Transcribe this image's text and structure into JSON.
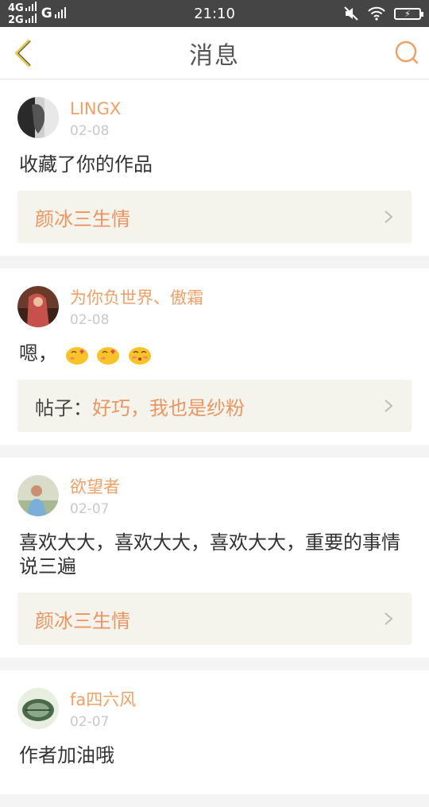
{
  "status_bar": {
    "network_top": "4G",
    "network_bottom": "2G",
    "carrier": "G",
    "time": "21:10"
  },
  "header": {
    "title": "消息",
    "back_icon": "chevron-left-icon",
    "search_icon": "search-icon"
  },
  "messages": [
    {
      "username": "LINGX",
      "date": "02-08",
      "text": "收藏了你的作品",
      "ref_label": "",
      "ref_title": "颜冰三生情"
    },
    {
      "username": "为你负世界、傲霜",
      "date": "02-08",
      "text": "嗯，",
      "emojis": [
        "blush-heart-emoji",
        "blush-heart-emoji",
        "kiss-emoji"
      ],
      "ref_label": "帖子：",
      "ref_title": "好巧，我也是纱粉"
    },
    {
      "username": "欲望者",
      "date": "02-07",
      "text": "喜欢大大，喜欢大大，喜欢大大，重要的事情说三遍",
      "ref_label": "",
      "ref_title": "颜冰三生情"
    },
    {
      "username": "fa四六风",
      "date": "02-07",
      "text": "作者加油哦"
    }
  ],
  "colors": {
    "accent": "#f0a065",
    "ref_bg": "#f4f4ec"
  }
}
